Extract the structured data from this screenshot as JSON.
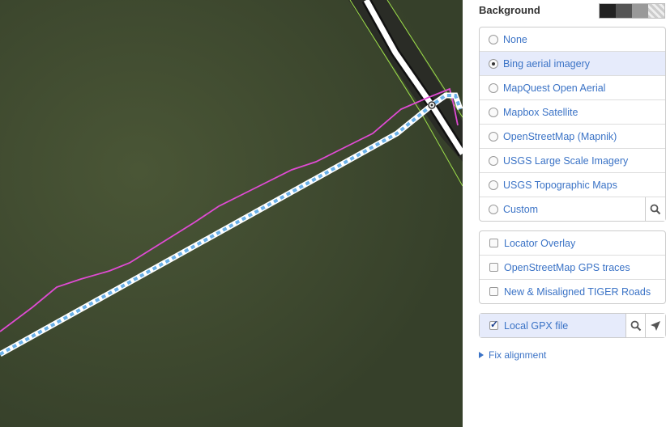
{
  "panel": {
    "background_title": "Background",
    "imagery": [
      {
        "label": "None",
        "checked": false
      },
      {
        "label": "Bing aerial imagery",
        "checked": true
      },
      {
        "label": "MapQuest Open Aerial",
        "checked": false
      },
      {
        "label": "Mapbox Satellite",
        "checked": false
      },
      {
        "label": "OpenStreetMap (Mapnik)",
        "checked": false
      },
      {
        "label": "USGS Large Scale Imagery",
        "checked": false
      },
      {
        "label": "USGS Topographic Maps",
        "checked": false
      },
      {
        "label": "Custom",
        "checked": false
      }
    ],
    "overlays": [
      {
        "label": "Locator Overlay",
        "checked": false
      },
      {
        "label": "OpenStreetMap GPS traces",
        "checked": false
      },
      {
        "label": "New & Misaligned TIGER Roads",
        "checked": false
      }
    ],
    "gpx": {
      "label": "Local GPX file",
      "checked": true
    },
    "fix_alignment": "Fix alignment",
    "icons": {
      "custom_action": "search-icon",
      "gpx_zoom": "search-icon",
      "gpx_locate": "location-arrow-icon"
    }
  },
  "colors": {
    "accent": "#3b73c6",
    "selected_row": "#e6ebfb",
    "gpx_track": "#e04bd4",
    "selected_way": "#6ab0e8",
    "terrain": "#3f4a2e"
  }
}
